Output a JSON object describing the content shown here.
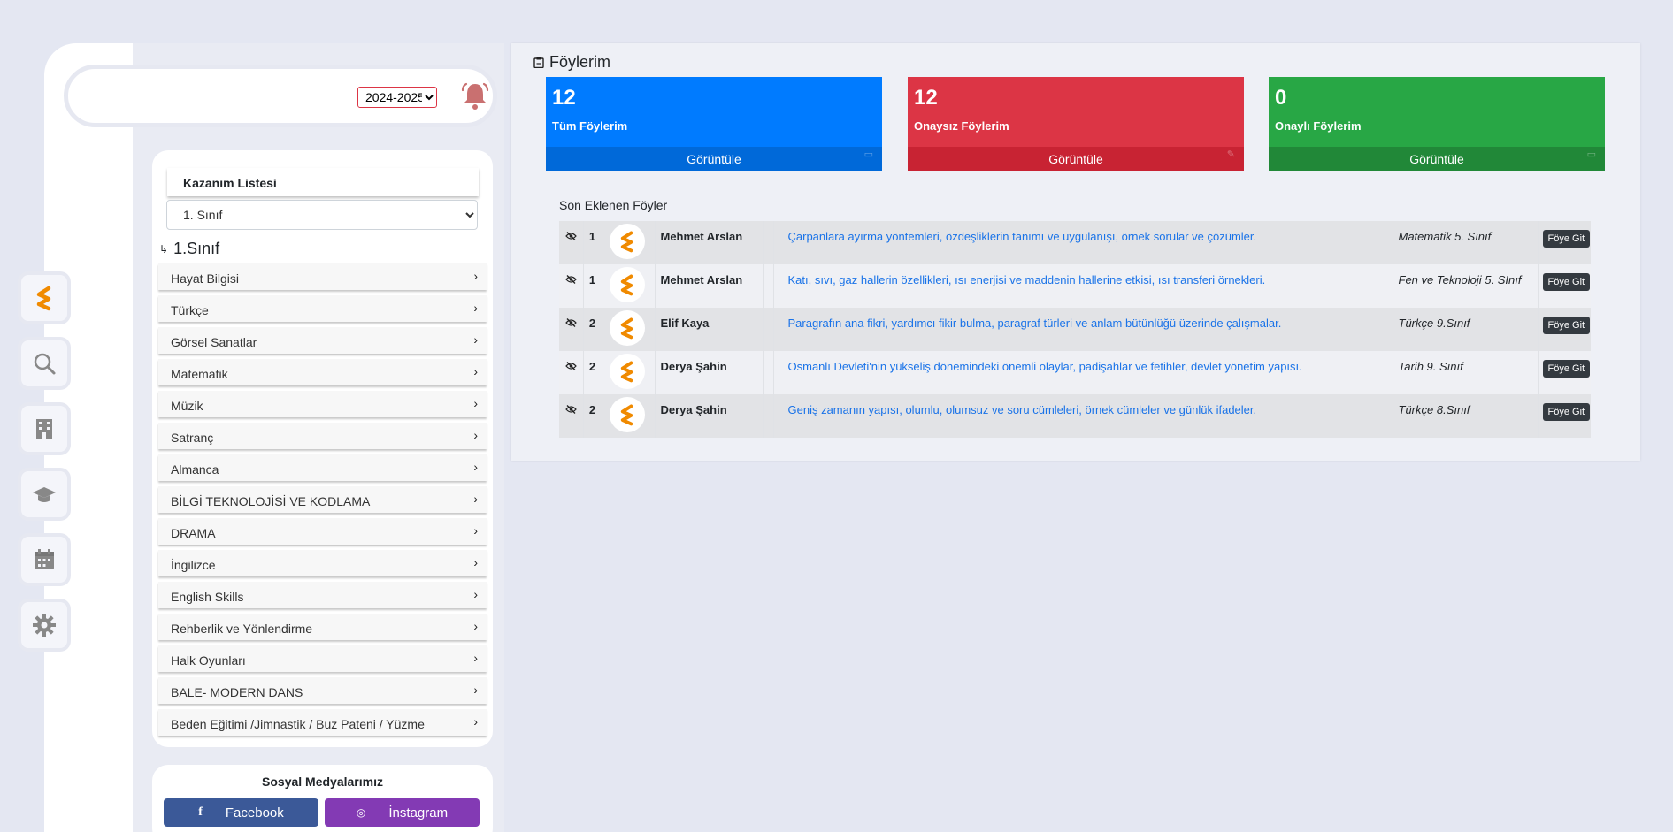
{
  "header": {
    "year_options": [
      "2024-2025"
    ],
    "year_selected": "2024-2025"
  },
  "rail": {
    "items": [
      {
        "icon": "brand-logo-icon"
      },
      {
        "icon": "search-icon"
      },
      {
        "icon": "building-icon"
      },
      {
        "icon": "graduation-cap-icon"
      },
      {
        "icon": "calendar-icon"
      },
      {
        "icon": "gear-icon"
      }
    ]
  },
  "kazanim": {
    "title": "Kazanım Listesi",
    "class_selected": "1. Sınıf",
    "heading_arrow": "↳",
    "heading": "1.Sınıf",
    "subjects": [
      "Hayat Bilgisi",
      "Türkçe",
      "Görsel Sanatlar",
      "Matematik",
      "Müzik",
      "Satranç",
      "Almanca",
      "BİLGİ TEKNOLOJİSİ VE KODLAMA",
      "DRAMA",
      "İngilizce",
      "English Skills",
      "Rehberlik ve Yönlendirme",
      "Halk Oyunları",
      "BALE- MODERN DANS",
      "Beden Eğitimi /Jimnastik / Buz Pateni / Yüzme"
    ]
  },
  "social": {
    "title": "Sosyal Medyalarımız",
    "facebook_icon": "f",
    "facebook": "Facebook",
    "instagram_icon": "◎",
    "instagram": "İnstagram"
  },
  "main": {
    "title": "Föylerim",
    "stats": [
      {
        "count": "12",
        "label": "Tüm Föylerim",
        "action": "Görüntüle",
        "icon": "▭",
        "color": "#007bff"
      },
      {
        "count": "12",
        "label": "Onaysız Föylerim",
        "action": "Görüntüle",
        "icon": "✎",
        "color": "#dc3545"
      },
      {
        "count": "0",
        "label": "Onaylı Föylerim",
        "action": "Görüntüle",
        "icon": "▭",
        "color": "#28a745"
      }
    ],
    "recent_title": "Son Eklenen Föyler",
    "rows": [
      {
        "num": "1",
        "author": "Mehmet Arslan",
        "desc": "Çarpanlara ayırma yöntemleri, özdeşliklerin tanımı ve uygulanışı, örnek sorular ve çözümler.",
        "cls": "Matematik 5. Sınıf",
        "btn": "Föye Git"
      },
      {
        "num": "1",
        "author": "Mehmet Arslan",
        "desc": "Katı, sıvı, gaz hallerin özellikleri, ısı enerjisi ve maddenin hallerine etkisi, ısı transferi örnekleri.",
        "cls": "Fen ve Teknoloji 5. SInıf",
        "btn": "Föye Git"
      },
      {
        "num": "2",
        "author": "Elif Kaya",
        "desc": "Paragrafın ana fikri, yardımcı fikir bulma, paragraf türleri ve anlam bütünlüğü üzerinde çalışmalar.",
        "cls": "Türkçe 9.Sınıf",
        "btn": "Föye Git"
      },
      {
        "num": "2",
        "author": "Derya Şahin",
        "desc": "Osmanlı Devleti'nin yükseliş dönemindeki önemli olaylar, padişahlar ve fetihler, devlet yönetim yapısı.",
        "cls": "Tarih 9. Sınıf",
        "btn": "Föye Git"
      },
      {
        "num": "2",
        "author": "Derya Şahin",
        "desc": "Geniş zamanın yapısı, olumlu, olumsuz ve soru cümleleri, örnek cümleler ve günlük ifadeler.",
        "cls": "Türkçe 8.Sınıf",
        "btn": "Föye Git"
      }
    ]
  }
}
